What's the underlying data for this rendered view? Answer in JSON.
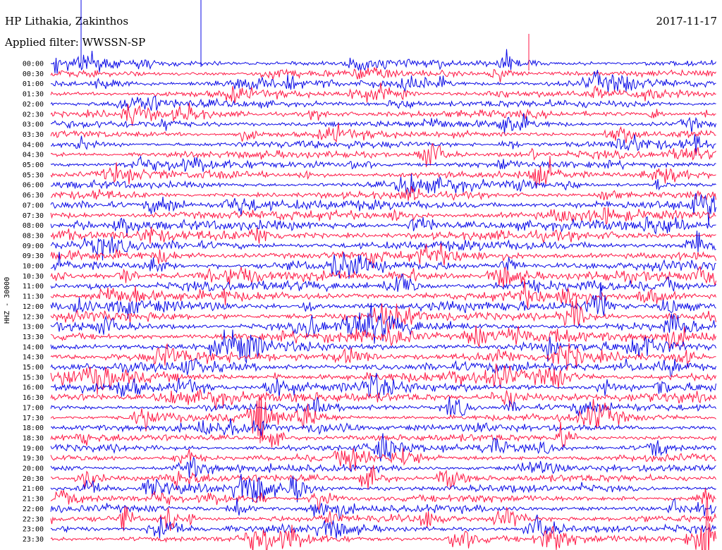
{
  "header": {
    "station": "HP Lithakia, Zakinthos",
    "date": "2017-11-17",
    "filter": "Applied filter: WWSSN-SP"
  },
  "colors": {
    "trace_a": "#0a0ae6",
    "trace_b": "#ff1744",
    "text": "#000000",
    "background": "#ffffff"
  },
  "chart_data": {
    "type": "line",
    "title": "HP Lithakia, Zakinthos",
    "channel_label": "HHZ - 30000",
    "y_tick_labels": [
      "00:00",
      "00:30",
      "01:00",
      "01:30",
      "02:00",
      "02:30",
      "03:00",
      "03:30",
      "04:00",
      "04:30",
      "05:00",
      "05:30",
      "06:00",
      "06:30",
      "07:00",
      "07:30",
      "08:00",
      "08:30",
      "09:00",
      "09:30",
      "10:00",
      "10:30",
      "11:00",
      "11:30",
      "12:00",
      "12:30",
      "13:00",
      "13:30",
      "14:00",
      "14:30",
      "15:00",
      "15:30",
      "16:00",
      "16:30",
      "17:00",
      "17:30",
      "18:00",
      "18:30",
      "19:00",
      "19:30",
      "20:00",
      "20:30",
      "21:00",
      "21:30",
      "22:00",
      "22:30",
      "23:00",
      "23:30"
    ],
    "series": [
      {
        "color": "#0a0ae6",
        "rows": "even"
      },
      {
        "color": "#ff1744",
        "rows": "odd"
      }
    ],
    "row_minutes": 30,
    "grid": false,
    "legend": "none"
  }
}
